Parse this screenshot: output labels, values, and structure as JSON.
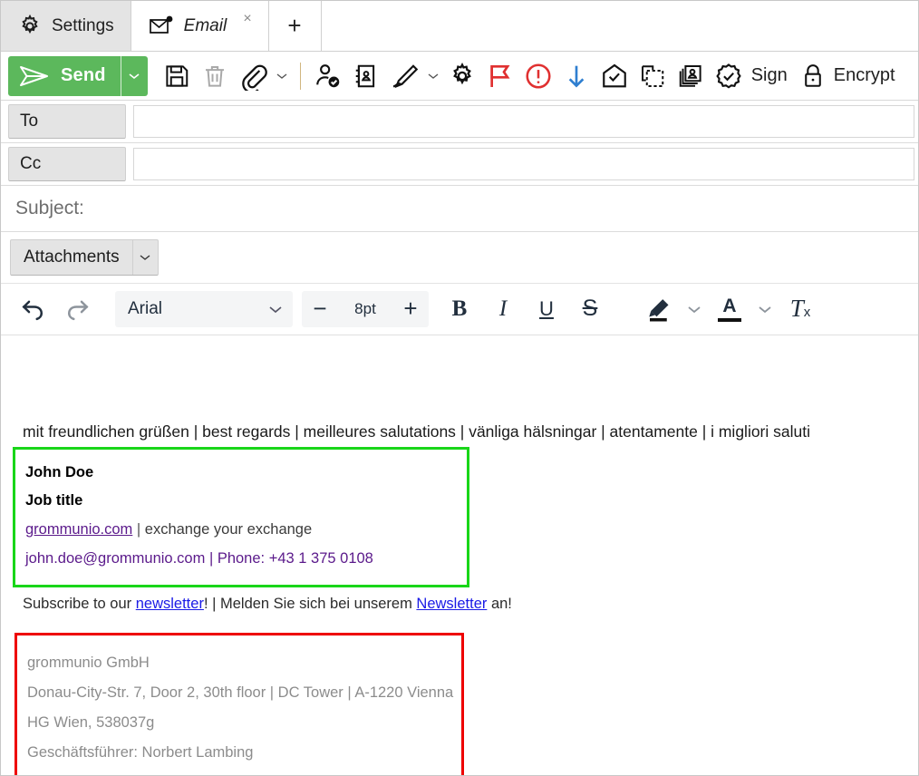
{
  "tabs": [
    {
      "label": "Settings",
      "icon": "gear-icon",
      "active": false,
      "closable": false
    },
    {
      "label": "Email",
      "icon": "envelope-new-mail-icon",
      "active": true,
      "closable": true,
      "close_glyph": "×"
    }
  ],
  "new_tab_glyph": "+",
  "toolbar": {
    "send_label": "Send",
    "send_color": "#5cb85c",
    "items": [
      {
        "name": "save-draft-icon",
        "title": "Save"
      },
      {
        "name": "delete-icon",
        "title": "Delete"
      },
      {
        "name": "attach-file-icon",
        "title": "Attach"
      },
      {
        "name": "attach-dropdown-caret-icon",
        "title": "Attach options"
      },
      {
        "name": "check-names-icon",
        "title": "Check names"
      },
      {
        "name": "address-book-icon",
        "title": "Address book"
      },
      {
        "name": "signature-icon",
        "title": "Signature"
      },
      {
        "name": "signature-dropdown-caret-icon",
        "title": "Signature options"
      },
      {
        "name": "options-gear-icon",
        "title": "Options"
      },
      {
        "name": "flag-icon",
        "title": "Follow up"
      },
      {
        "name": "high-importance-icon",
        "title": "High importance"
      },
      {
        "name": "low-importance-icon",
        "title": "Low importance"
      },
      {
        "name": "read-receipt-icon",
        "title": "Read receipt"
      },
      {
        "name": "paste-special-icon",
        "title": "Paste special"
      },
      {
        "name": "contact-card-icon",
        "title": "Contact card"
      }
    ],
    "sign_label": "Sign",
    "sign_icon": "sign-badge-check-icon",
    "encrypt_label": "Encrypt",
    "encrypt_icon": "lock-icon"
  },
  "recipients": [
    {
      "button_label": "To",
      "value": "",
      "placeholder": ""
    },
    {
      "button_label": "Cc",
      "value": "",
      "placeholder": ""
    }
  ],
  "subject": {
    "value": "",
    "placeholder": "Subject:"
  },
  "attachments": {
    "label": "Attachments",
    "caret_icon": "chevron-down-icon"
  },
  "format_toolbar": {
    "undo_icon": "undo-icon",
    "redo_icon": "redo-icon",
    "font_family": "Arial",
    "font_family_caret": "chevron-down-icon",
    "decrease_label": "−",
    "font_size": "8pt",
    "increase_label": "+",
    "bold_label": "B",
    "italic_label": "I",
    "underline_label": "U",
    "strikethrough_label": "S",
    "highlight_icon": "highlight-pen-icon",
    "highlight_caret": "chevron-down-icon",
    "text_color_label": "A",
    "text_color_caret": "chevron-down-icon",
    "clear_formatting_label": "T",
    "clear_formatting_sub": "x"
  },
  "body": {
    "greeting": "mit freundlichen grüßen | best regards | meilleures salutations | vänliga hälsningar | atentamente | i migliori saluti",
    "signature_box": {
      "border_color": "#19d619",
      "name": "John Doe",
      "job_title": "Job title",
      "website": "grommunio.com",
      "website_sep": " | ",
      "tagline": "exchange your exchange",
      "email": "john.doe@grommunio.com",
      "email_sep": " | ",
      "phone": "Phone: +43 1 375 0108"
    },
    "subscribe": {
      "prefix": "Subscribe to our ",
      "link_en": "newsletter",
      "mid": "! | Melden Sie sich bei unserem ",
      "link_de": "Newsletter",
      "suffix": " an!"
    },
    "legal_box": {
      "border_color": "#ee0000",
      "lines": [
        "grommunio GmbH",
        "Donau-City-Str. 7, Door 2, 30th floor | DC Tower | A-1220 Vienna",
        "HG Wien, 538037g",
        "Geschäftsführer: Norbert Lambing"
      ]
    }
  }
}
